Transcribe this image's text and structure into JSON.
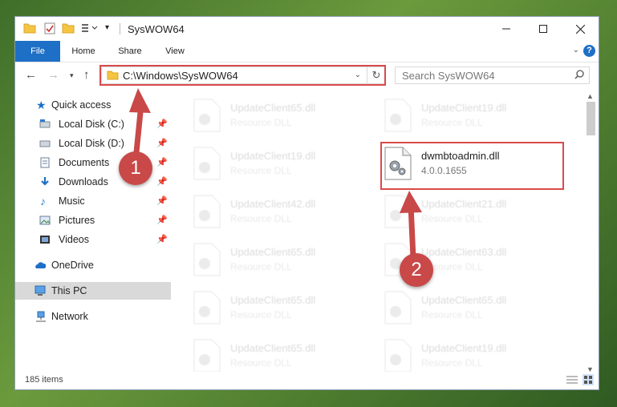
{
  "window": {
    "title": "SysWOW64"
  },
  "ribbon": {
    "tabs": [
      "File",
      "Home",
      "Share",
      "View"
    ],
    "help": "?"
  },
  "address": {
    "path": "C:\\Windows\\SysWOW64",
    "search_placeholder": "Search SysWOW64"
  },
  "nav": {
    "quick_access": "Quick access",
    "items": [
      {
        "label": "Local Disk (C:)",
        "icon": "drive-icon"
      },
      {
        "label": "Local Disk (D:)",
        "icon": "drive-icon"
      },
      {
        "label": "Documents",
        "icon": "documents-icon"
      },
      {
        "label": "Downloads",
        "icon": "downloads-icon"
      },
      {
        "label": "Music",
        "icon": "music-icon"
      },
      {
        "label": "Pictures",
        "icon": "pictures-icon"
      },
      {
        "label": "Videos",
        "icon": "videos-icon"
      }
    ],
    "onedrive": "OneDrive",
    "this_pc": "This PC",
    "network": "Network"
  },
  "files": {
    "left": [
      {
        "name": "UpdateClient65.dll",
        "type": "Resource DLL"
      },
      {
        "name": "UpdateClient19.dll",
        "type": "Resource DLL"
      },
      {
        "name": "UpdateClient42.dll",
        "type": "Resource DLL"
      },
      {
        "name": "UpdateClient65.dll",
        "type": "Resource DLL"
      },
      {
        "name": "UpdateClient65.dll",
        "type": "Resource DLL"
      },
      {
        "name": "UpdateClient65.dll",
        "type": "Resource DLL"
      }
    ],
    "right_top": {
      "name": "UpdateClient19.dll",
      "type": "Resource DLL"
    },
    "highlighted": {
      "name": "dwmbtoadmin.dll",
      "version": "4.0.0.1655"
    },
    "right_rest": [
      {
        "name": "UpdateClient21.dll",
        "type": "Resource DLL"
      },
      {
        "name": "UpdateClient63.dll",
        "type": "Resource DLL"
      },
      {
        "name": "UpdateClient65.dll",
        "type": "Resource DLL"
      },
      {
        "name": "UpdateClient19.dll",
        "type": "Resource DLL"
      }
    ]
  },
  "status": {
    "items_count": "185 items"
  },
  "annotations": {
    "step1": "1",
    "step2": "2",
    "color": "#c94848"
  }
}
